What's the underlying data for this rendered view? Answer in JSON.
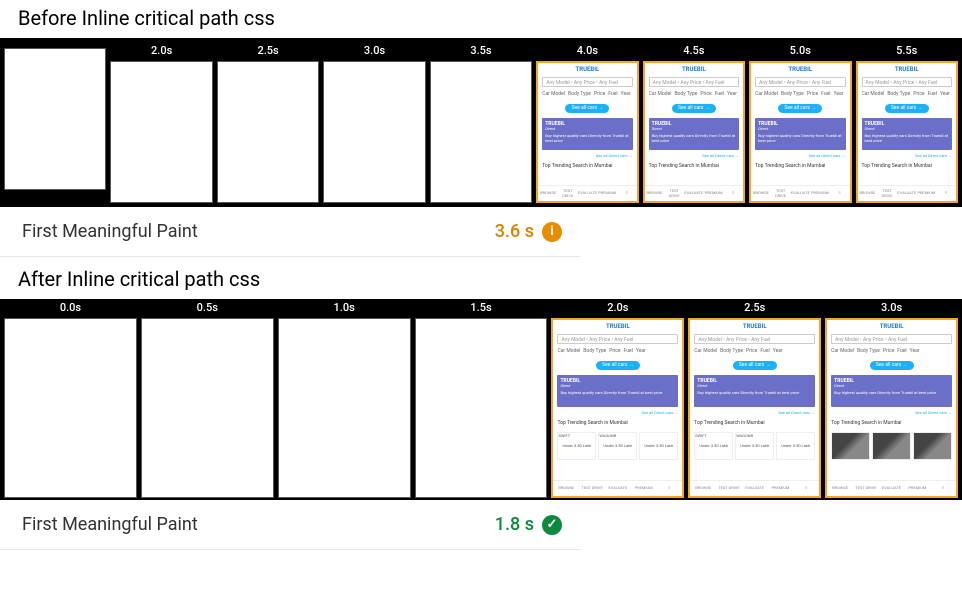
{
  "before": {
    "title": "Before Inline critical path css",
    "filmstrip": {
      "timestamps": [
        "",
        "2.0s",
        "2.5s",
        "3.0s",
        "3.5s",
        "4.0s",
        "4.5s",
        "5.0s",
        "5.5s"
      ],
      "renderedFrom": 5
    },
    "metric": {
      "label": "First Meaningful Paint",
      "value": "3.6 s",
      "status": "warn",
      "iconGlyph": "i"
    }
  },
  "after": {
    "title": "After Inline critical path css",
    "filmstrip": {
      "timestamps": [
        "0.0s",
        "0.5s",
        "1.0s",
        "1.5s",
        "2.0s",
        "2.5s",
        "3.0s"
      ],
      "renderedFrom": 4
    },
    "metric": {
      "label": "First Meaningful Paint",
      "value": "1.8 s",
      "status": "pass",
      "iconGlyph": "✓"
    }
  },
  "mock": {
    "logo": "TRUEBIL",
    "search": "Any Model • Any Price • Any Fuel",
    "pills": [
      "Car Model",
      "Body Type",
      "Price",
      "Fuel",
      "Year"
    ],
    "cta": "See all cars →",
    "bannerBrand": "TRUEBIL",
    "bannerSub": "Direct",
    "bannerText": "Buy highest quality cars Directly from Truebil at best price",
    "directLink": "See all Direct cars →",
    "trending": "Top Trending Search in Mumbai",
    "cardLabels": [
      "SWIFT",
      "WAGONR"
    ],
    "cardPrice": "Under 3.50 Lakh",
    "bottomNav": [
      "BROWSE",
      "TEST DRIVE",
      "EVALUATE",
      "PREMIUM",
      "≡"
    ]
  }
}
